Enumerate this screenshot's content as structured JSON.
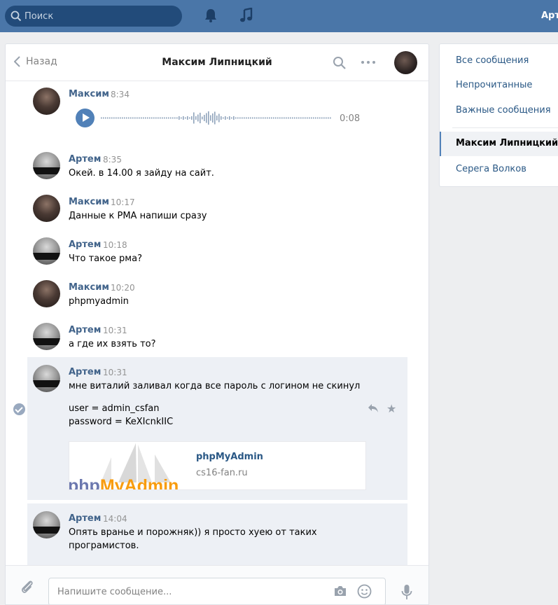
{
  "topbar": {
    "search_placeholder": "Поиск",
    "user_name": "Арт"
  },
  "chat": {
    "back_label": "Назад",
    "title": "Максим Липницкий",
    "input_placeholder": "Напишите сообщение..."
  },
  "messages": [
    {
      "author": "Максим",
      "time": "8:34",
      "type": "voice",
      "duration": "0:08"
    },
    {
      "author": "Артем",
      "time": "8:35",
      "text": "Окей. в 14.00 я зайду на сайт."
    },
    {
      "author": "Максим",
      "time": "10:17",
      "text": "Данные к РМА напиши сразу"
    },
    {
      "author": "Артем",
      "time": "10:18",
      "text": "Что такое рма?"
    },
    {
      "author": "Максим",
      "time": "10:20",
      "text": "phpmyadmin"
    },
    {
      "author": "Артем",
      "time": "10:31",
      "text": "а где их взять то?"
    },
    {
      "author": "Артем",
      "time": "10:31",
      "selected": true,
      "text": "мне виталий заливал когда все пароль с логином не скинул",
      "line2": "user = admin_csfan",
      "line3": "password = KeXIcnkIIC",
      "link": {
        "title": "phpMyAdmin",
        "domain": "cs16-fan.ru",
        "logo_text": "phpMyAdmin"
      }
    },
    {
      "author": "Артем",
      "time": "14:04",
      "selected": true,
      "text": "Опять вранье и порожняк)) я просто хуею от таких",
      "line2": "програмистов."
    }
  ],
  "sidebar": {
    "items": [
      {
        "label": "Все сообщения"
      },
      {
        "label": "Непрочитанные"
      },
      {
        "label": "Важные сообщения"
      }
    ],
    "conversations": [
      {
        "label": "Максим Липницкий",
        "active": true
      },
      {
        "label": "Серега Волков",
        "active": false
      }
    ]
  },
  "colors": {
    "topbar": "#4a76a8",
    "link": "#2a5885",
    "author": "#42648b",
    "accent": "#5181b8"
  }
}
